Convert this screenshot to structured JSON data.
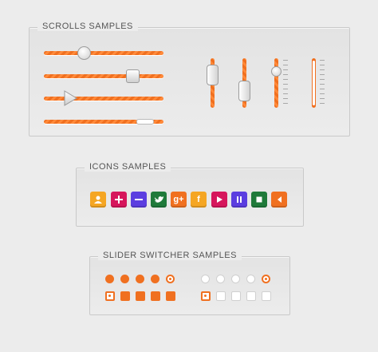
{
  "panels": {
    "scrolls": {
      "title": "SCROLLS SAMPLES"
    },
    "icons": {
      "title": "ICONS SAMPLES"
    },
    "switcher": {
      "title": "SLIDER SWITCHER SAMPLES"
    }
  },
  "colors": {
    "accent": "#f07020",
    "panel_border": "#c9c9c9",
    "background": "#ececec"
  },
  "scrolls": {
    "horizontal": [
      {
        "knob": "circle",
        "value": 0.33
      },
      {
        "knob": "square",
        "value": 0.74
      },
      {
        "knob": "play-triangle",
        "value": 0.2
      },
      {
        "knob": "pill",
        "value": 0.84
      }
    ],
    "vertical": [
      {
        "knob": "rounded-rect",
        "value": 0.3
      },
      {
        "knob": "rounded-rect",
        "value": 0.6
      },
      {
        "knob": "circle-with-ticks",
        "value": 0.25
      },
      {
        "knob": "white-fill-with-ticks",
        "value": 0.05
      }
    ]
  },
  "icons": [
    {
      "name": "user-icon",
      "color": "#f5a623"
    },
    {
      "name": "plus-icon",
      "color": "#d6165c"
    },
    {
      "name": "minus-icon",
      "color": "#5b3ee0"
    },
    {
      "name": "twitter-icon",
      "color": "#1f7a3a"
    },
    {
      "name": "google-plus-icon",
      "color": "#f07020",
      "label": "g+"
    },
    {
      "name": "facebook-icon",
      "color": "#f5a623",
      "label": "f"
    },
    {
      "name": "play-icon",
      "color": "#d6165c"
    },
    {
      "name": "pause-icon",
      "color": "#5b3ee0"
    },
    {
      "name": "stop-icon",
      "color": "#1f7a3a"
    },
    {
      "name": "volume-icon",
      "color": "#f07020"
    }
  ],
  "switcher": {
    "orange_dots_active": 5,
    "orange_squares_active": 5,
    "white_dots_active": 5,
    "white_squares_active": 1
  }
}
